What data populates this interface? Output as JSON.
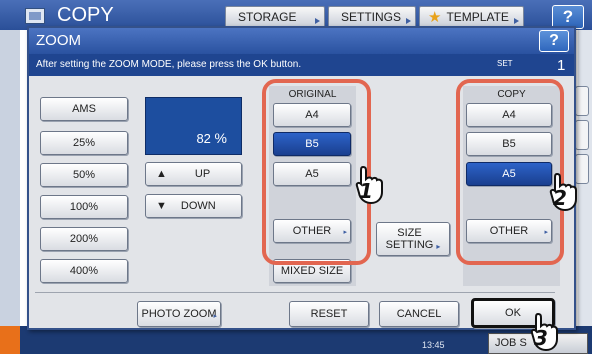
{
  "background": {
    "title": "COPY",
    "tabs": [
      "STORAGE",
      "SETTINGS",
      "TEMPLATE"
    ],
    "help": "?",
    "time": "13:45",
    "job_button": "JOB S"
  },
  "dialog": {
    "title": "ZOOM",
    "help": "?",
    "message": "After setting the ZOOM MODE, please press the OK button.",
    "set_label": "SET",
    "set_count": "1"
  },
  "zoom": {
    "presets": [
      "AMS",
      "25%",
      "50%",
      "100%",
      "200%",
      "400%"
    ],
    "value": "82",
    "unit": "%",
    "up_label": "UP",
    "down_label": "DOWN"
  },
  "original": {
    "label": "ORIGINAL",
    "sizes": [
      "A4",
      "B5",
      "A5"
    ],
    "selected": "B5",
    "other": "OTHER",
    "mixed": "MIXED SIZE"
  },
  "size_setting": "SIZE\nSETTING",
  "copy": {
    "label": "COPY",
    "sizes": [
      "A4",
      "B5",
      "A5"
    ],
    "selected": "A5",
    "other": "OTHER"
  },
  "footer": {
    "photo_zoom": "PHOTO ZOOM",
    "reset": "RESET",
    "cancel": "CANCEL",
    "ok": "OK"
  },
  "callouts": [
    "1",
    "2",
    "3"
  ],
  "colors": {
    "accent": "#1d4e9f",
    "selected": "#1a3f8f",
    "highlight": "#e26650"
  }
}
